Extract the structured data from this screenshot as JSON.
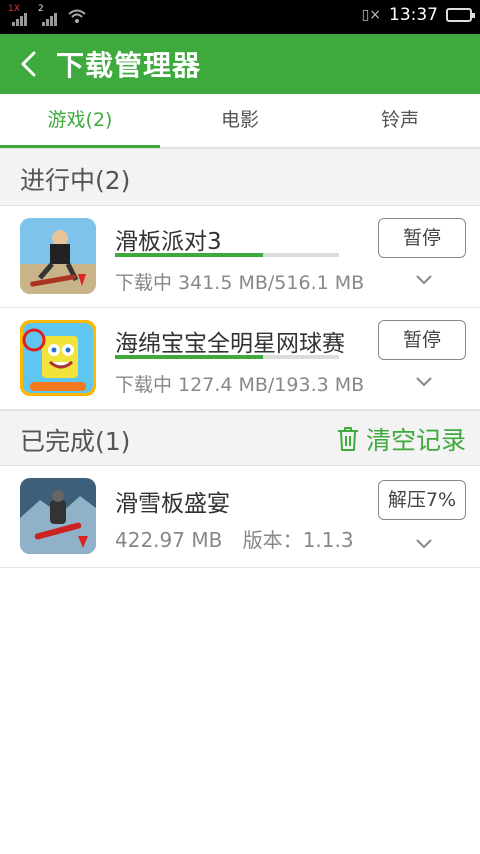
{
  "status_bar": {
    "sim1_label": "1X",
    "sim2_label": "2",
    "time": "13:37",
    "icons": [
      "signal-icon",
      "wifi-icon",
      "vibrate-icon",
      "battery-icon"
    ]
  },
  "app_bar": {
    "title": "下载管理器",
    "back_icon": "back-arrow-icon"
  },
  "tabs": [
    {
      "label": "游戏(2)",
      "active": true
    },
    {
      "label": "电影",
      "active": false
    },
    {
      "label": "铃声",
      "active": false
    }
  ],
  "in_progress": {
    "header": "进行中(2)",
    "items": [
      {
        "name": "滑板派对3",
        "size_text": "下载中 341.5 MB/516.1 MB",
        "progress": 0.66,
        "button": "暂停"
      },
      {
        "name": "海绵宝宝全明星网球赛",
        "size_text": "下载中 127.4 MB/193.3 MB",
        "progress": 0.66,
        "button": "暂停"
      }
    ]
  },
  "completed": {
    "header": "已完成(1)",
    "clear_label": "清空记录",
    "items": [
      {
        "name": "滑雪板盛宴",
        "size": "422.97 MB",
        "version_label": "版本：",
        "version": "1.1.3",
        "button": "解压7%"
      }
    ]
  },
  "colors": {
    "accent": "#3eaa3e",
    "status_bar": "#000000",
    "progress_track": "#dcdcdc"
  }
}
